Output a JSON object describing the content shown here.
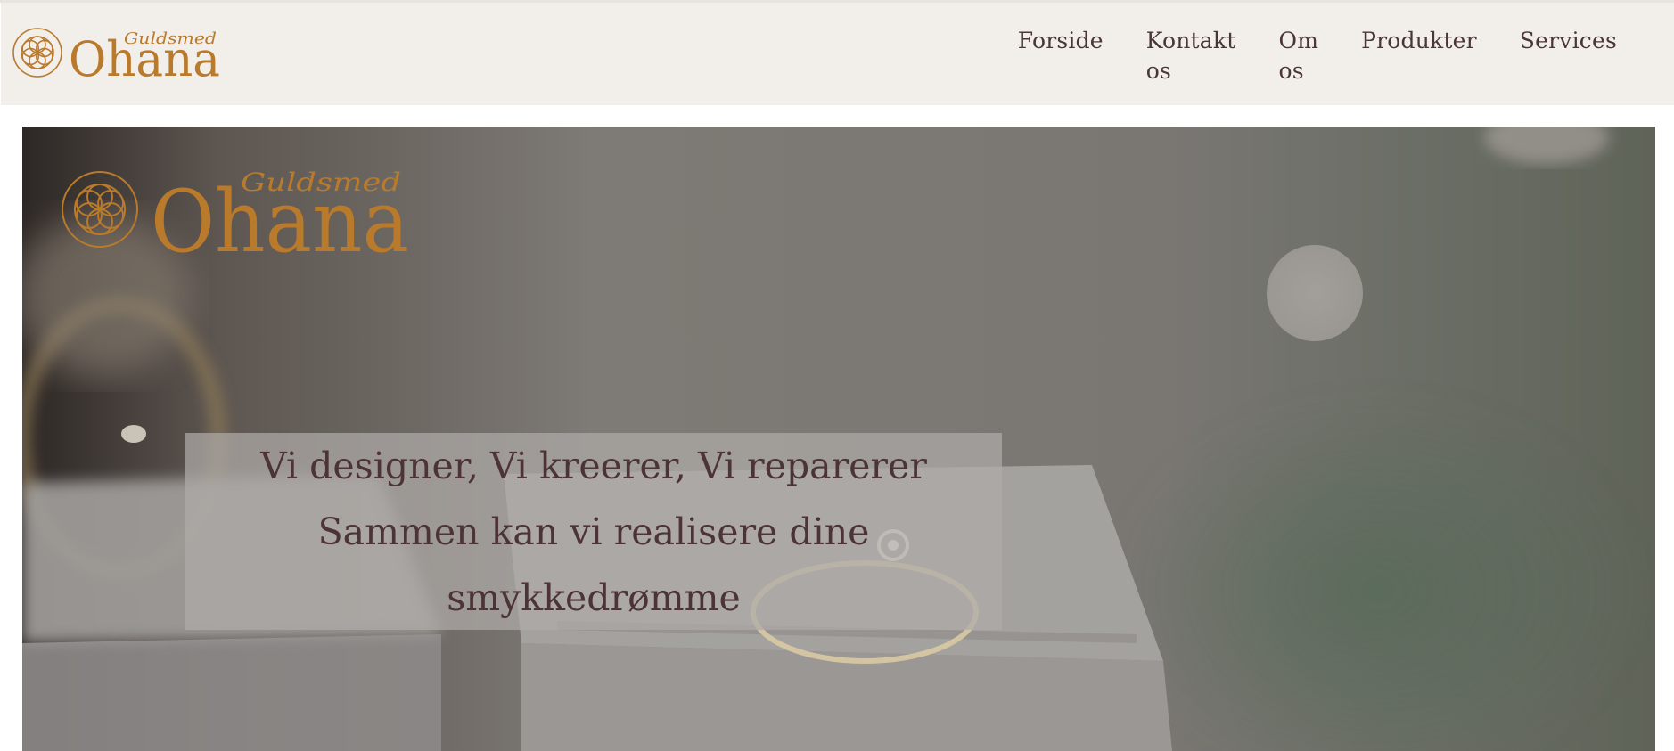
{
  "header": {
    "logo": {
      "wordmark": "Ohana",
      "script_text": "Guldsmed",
      "icon": "flower-of-life-icon",
      "color": "#b97a2c"
    },
    "nav": [
      {
        "label_lines": [
          "Forside"
        ]
      },
      {
        "label_lines": [
          "Kontakt",
          "os"
        ]
      },
      {
        "label_lines": [
          "Om",
          "os"
        ]
      },
      {
        "label_lines": [
          "Produkter"
        ]
      },
      {
        "label_lines": [
          "Services"
        ]
      }
    ]
  },
  "hero": {
    "logo": {
      "wordmark": "Ohana",
      "script_text": "Guldsmed"
    },
    "tagline_lines": [
      "Vi designer, Vi kreerer, Vi reparerer",
      "Sammen kan vi realisere dine",
      "smykkedrømme"
    ]
  },
  "colors": {
    "header_bg": "#f2eeea",
    "nav_text": "#4a3638",
    "brand_gold": "#b97a2c",
    "tagline_text": "#4c3436"
  }
}
